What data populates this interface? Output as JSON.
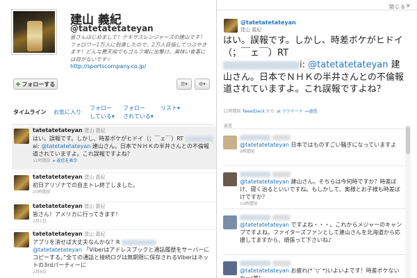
{
  "profile": {
    "name": "建山 義紀",
    "handle": "@tatetatetateyan",
    "bio": "皆さんはじめまして！テキサスレンジャーズの建山です！フォロワー1万人に到達したので、2万人目指してつぶやきます！どんな悪天候でもゴルフ場に出撃け。美味い食事には目がないです☆",
    "url": "http://sportscompany.co.jp/",
    "follow_label": "フォローする",
    "tabs": [
      "タイムライン",
      "お気に入り",
      "フォロー\nしている▾",
      "フォロー\nされている▾",
      "リスト▾"
    ]
  },
  "timeline": [
    {
      "user": "tatetatetateyan",
      "realname": "建山 義紀",
      "text1": "はい。誤報です。しかし、時差ボケがヒドイ（；￣ェ￣）RT",
      "text2": "ai:",
      "mention": "@tatetatetateyan",
      "text3": "建山さん。日本でＮＨＫの半井さんとの不倫報道されていますよ。これ誤報ですよね？",
      "meta": "11時間前",
      "actions": "▸ 返信を表示"
    },
    {
      "user": "tatetatetateyan",
      "realname": "建山 義紀",
      "text": "初日アリゾナでの自主トレ終了しました。",
      "meta": "20時間前"
    },
    {
      "user": "tatetatetateyan",
      "realname": "建山 義紀",
      "text": "皆さん！アメリカに行ってきます！",
      "meta": "2月1日"
    },
    {
      "user": "tatetatetateyan",
      "realname": "建山 義紀",
      "text": "アプリを消せば大丈夫なんかな？R",
      "mention": "@tatetatetateyan",
      "text2": "「Viberはアドレスブックと通話履歴をサーバーにコピーする。”全ての通話と接続ログは無期限に保存されるViberはネットの3rdパーティーに",
      "meta": "2月6日"
    }
  ],
  "detail": {
    "close": "閉じる",
    "handle": "@tatetatetateyan",
    "realname": "建山 義紀",
    "body1": "はい。誤報です。しかし、時差ボケがヒドイ（；￣ェ￣）RT",
    "body2": "i:",
    "mention": "@tatetatetateyan",
    "body3": "建山さん。日本でＮＨＫの半井さんとの不倫報道されていますよ。これ誤報ですよね？",
    "meta": "11時間前",
    "via": "TweetDeck",
    "from": "から",
    "retweet": "リツイート",
    "reply": "返信",
    "replies_label": "返信",
    "replies": [
      {
        "mention": "@tatetatetateyan",
        "text": "日本ではものすごい騒ぎになっていますよ",
        "meta": "9時間前",
        "av": "#c8b08a"
      },
      {
        "mention": "@tatetatetateyan",
        "text": "建山さん。そちらは今何時ですか？時差ぼけ、寝く治るといいですね。もしかして、奥様とお子様も時差ぼけですか？",
        "meta": "10時間前",
        "av": "#6a5a4a"
      },
      {
        "mention": "@tatetatetateyan",
        "text": "ですよね・・・。これからメジャーのキャンプですよね。ファイターズファンとして建山さんを北海道から応援してますから、頑張って下さいね♪",
        "meta": "",
        "av": "#7a8ea8"
      },
      {
        "mention": "@tatetatetateyan",
        "text": "お疲れ(*´▽`*)いよいよです！時差ボケないかー(笑)",
        "meta": "",
        "av": "#5a6a8a"
      }
    ]
  }
}
